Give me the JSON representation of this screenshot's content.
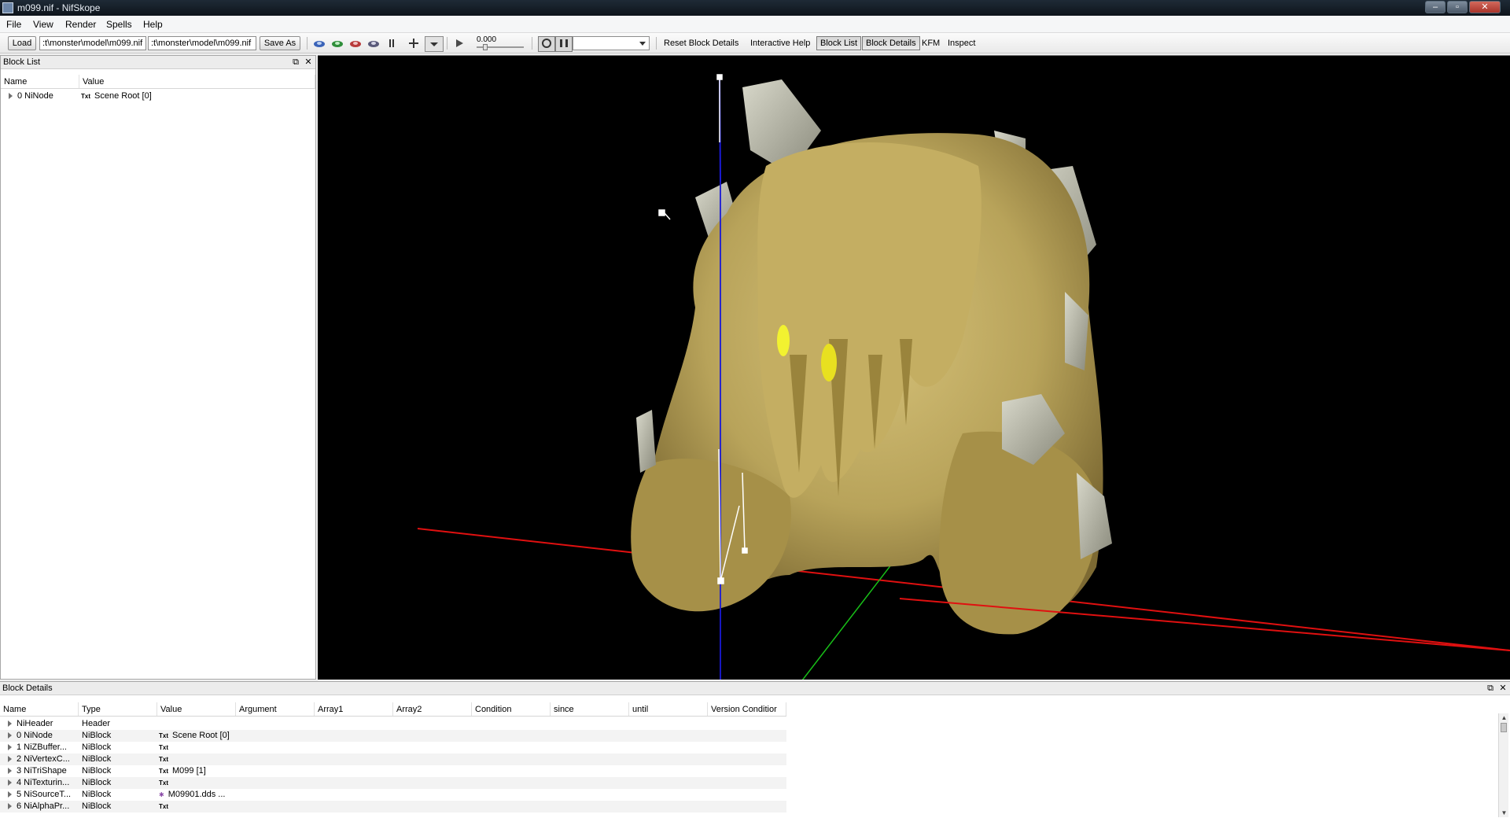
{
  "window": {
    "title": "m099.nif - NifSkope",
    "minimize": "–",
    "maximize": "▫",
    "close": "✕"
  },
  "menu": [
    "File",
    "View",
    "Render",
    "Spells",
    "Help"
  ],
  "toolbar": {
    "load_label": "Load",
    "load_path": ":t\\monster\\model\\m099.nif",
    "save_path": ":t\\monster\\model\\m099.nif",
    "save_as_label": "Save As",
    "time_value": "0.000",
    "reset_block_details": "Reset Block Details",
    "interactive_help": "Interactive Help",
    "block_list": "Block List",
    "block_details": "Block Details",
    "kfm": "KFM",
    "inspect": "Inspect"
  },
  "blocklist": {
    "title": "Block List",
    "columns": [
      "Name",
      "Value"
    ],
    "rows": [
      {
        "name": "0 NiNode",
        "icon": "Txt",
        "value": "Scene Root [0]"
      }
    ]
  },
  "blockdetails": {
    "title": "Block Details",
    "columns": [
      "Name",
      "Type",
      "Value",
      "Argument",
      "Array1",
      "Array2",
      "Condition",
      "since",
      "until",
      "Version Conditior"
    ],
    "rows": [
      {
        "name": "NiHeader",
        "type": "Header",
        "icon": "",
        "value": ""
      },
      {
        "name": "0 NiNode",
        "type": "NiBlock",
        "icon": "Txt",
        "value": "Scene Root [0]"
      },
      {
        "name": "1 NiZBuffer...",
        "type": "NiBlock",
        "icon": "Txt",
        "value": ""
      },
      {
        "name": "2 NiVertexC...",
        "type": "NiBlock",
        "icon": "Txt",
        "value": ""
      },
      {
        "name": "3 NiTriShape",
        "type": "NiBlock",
        "icon": "Txt",
        "value": "M099 [1]"
      },
      {
        "name": "4 NiTexturin...",
        "type": "NiBlock",
        "icon": "Txt",
        "value": ""
      },
      {
        "name": "5 NiSourceT...",
        "type": "NiBlock",
        "icon": "✱",
        "value": "M09901.dds ..."
      },
      {
        "name": "6 NiAlphaPr...",
        "type": "NiBlock",
        "icon": "Txt",
        "value": ""
      }
    ]
  },
  "colors": {
    "axis_x": "#e01010",
    "axis_y": "#18c018",
    "axis_z": "#1a1ad6",
    "model_body": "#b8a35a",
    "model_rock": "#b4b3a2",
    "eye_glow": "#f2f230"
  }
}
